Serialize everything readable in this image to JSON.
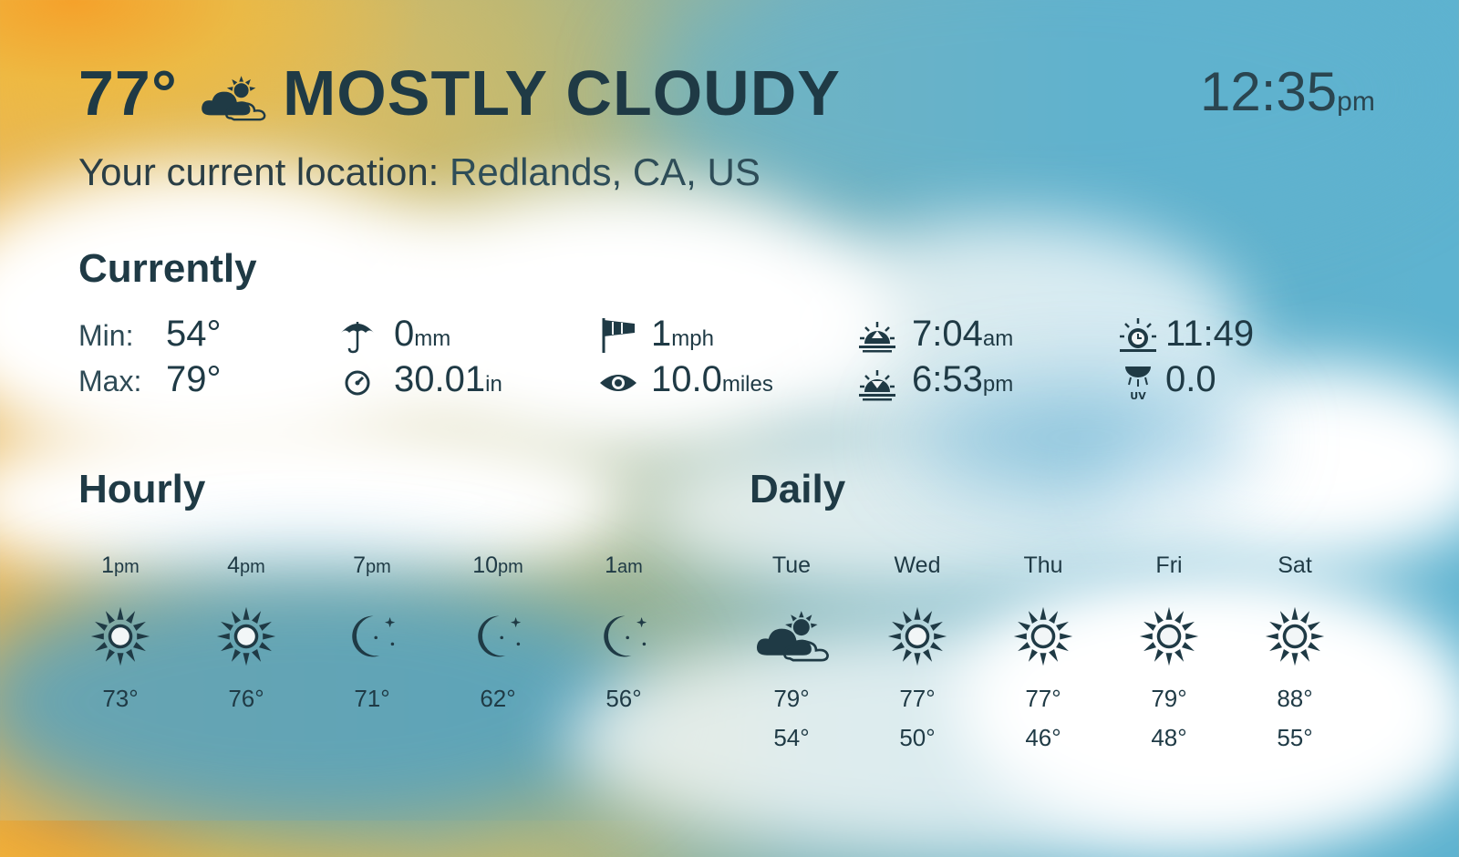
{
  "header": {
    "temperature": "77°",
    "condition_icon": "partly-cloudy-day-icon",
    "condition": "MOSTLY CLOUDY",
    "time": "12:35",
    "time_ampm": "pm",
    "location_label": "Your current location:",
    "location_value": "Redlands, CA, US"
  },
  "currently": {
    "title": "Currently",
    "min_label": "Min:",
    "min_value": "54°",
    "max_label": "Max:",
    "max_value": "79°",
    "precipitation": {
      "icon": "umbrella-icon",
      "value": "0",
      "unit": "mm"
    },
    "pressure": {
      "icon": "pressure-gauge-icon",
      "value": "30.01",
      "unit": "in"
    },
    "wind": {
      "icon": "windsock-icon",
      "value": "1",
      "unit": "mph"
    },
    "visibility": {
      "icon": "eye-icon",
      "value": "10.0",
      "unit": "miles"
    },
    "sunrise": {
      "icon": "sunrise-icon",
      "value": "7:04",
      "unit": "am"
    },
    "sunset": {
      "icon": "sunset-icon",
      "value": "6:53",
      "unit": "pm"
    },
    "daylight": {
      "icon": "daylight-clock-icon",
      "value": "11:49"
    },
    "uv": {
      "icon": "uv-index-icon",
      "value": "0.0"
    }
  },
  "hourly": {
    "title": "Hourly",
    "items": [
      {
        "hour": "1",
        "ampm": "pm",
        "icon": "sun-icon",
        "temp": "73°"
      },
      {
        "hour": "4",
        "ampm": "pm",
        "icon": "sun-icon",
        "temp": "76°"
      },
      {
        "hour": "7",
        "ampm": "pm",
        "icon": "moon-icon",
        "temp": "71°"
      },
      {
        "hour": "10",
        "ampm": "pm",
        "icon": "moon-icon",
        "temp": "62°"
      },
      {
        "hour": "1",
        "ampm": "am",
        "icon": "moon-icon",
        "temp": "56°"
      }
    ]
  },
  "daily": {
    "title": "Daily",
    "items": [
      {
        "day": "Tue",
        "icon": "partly-cloudy-day-icon",
        "high": "79°",
        "low": "54°"
      },
      {
        "day": "Wed",
        "icon": "sun-icon",
        "high": "77°",
        "low": "50°"
      },
      {
        "day": "Thu",
        "icon": "sun-icon",
        "high": "77°",
        "low": "46°"
      },
      {
        "day": "Fri",
        "icon": "sun-icon",
        "high": "79°",
        "low": "48°"
      },
      {
        "day": "Sat",
        "icon": "sun-icon",
        "high": "88°",
        "low": "55°"
      }
    ]
  },
  "colors": {
    "text": "#1f3a45",
    "sky_blue": "#5eb3d0",
    "sun_orange": "#f6a028"
  }
}
